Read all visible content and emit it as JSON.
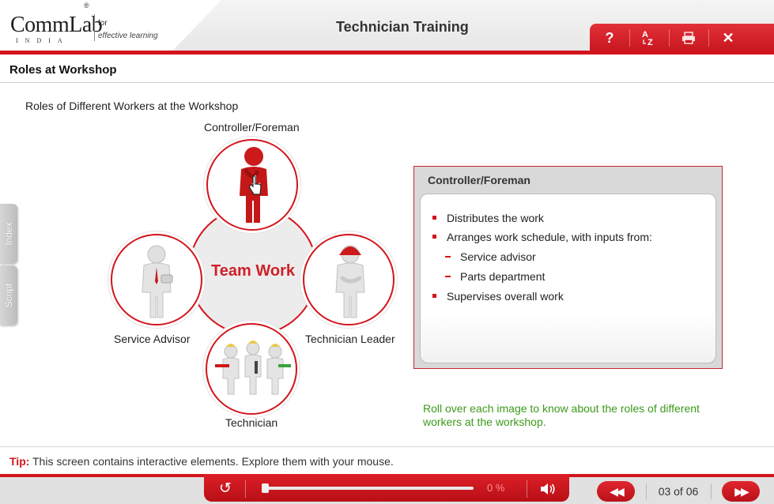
{
  "header": {
    "logo_main": "CommLab",
    "logo_sub": "INDIA",
    "logo_reg": "®",
    "logo_for": "for",
    "logo_tagline": "effective learning",
    "course_title": "Technician Training",
    "tools": [
      {
        "label": "?",
        "icon": "help-icon"
      },
      {
        "label": "AZ",
        "icon": "glossary-icon"
      },
      {
        "label": "print",
        "icon": "print-icon"
      },
      {
        "label": "✕",
        "icon": "close-icon"
      }
    ]
  },
  "page": {
    "title": "Roles at Workshop",
    "section_heading": "Roles of Different Workers at the Workshop"
  },
  "side_tabs": {
    "index": "Index",
    "script": "Script"
  },
  "diagram": {
    "center_label": "Team Work",
    "roles": {
      "controller": "Controller/Foreman",
      "advisor": "Service Advisor",
      "leader": "Technician Leader",
      "technician": "Technician"
    },
    "colors": {
      "accent": "#d3141c",
      "figure": "#dcdcdc",
      "active_figure": "#cc1a1a"
    }
  },
  "info_panel": {
    "title": "Controller/Foreman",
    "bullets": [
      "Distributes the work",
      "Arranges work schedule, with inputs from:",
      "Service advisor",
      "Parts department",
      "Supervises overall work"
    ]
  },
  "hint": "Roll over each image to know about the roles of different workers at the workshop.",
  "tip": {
    "label": "Tip:",
    "text": "This screen contains interactive elements. Explore them with your mouse."
  },
  "player": {
    "progress": 0,
    "progress_text": "0 %",
    "page_counter": "03 of 06"
  }
}
